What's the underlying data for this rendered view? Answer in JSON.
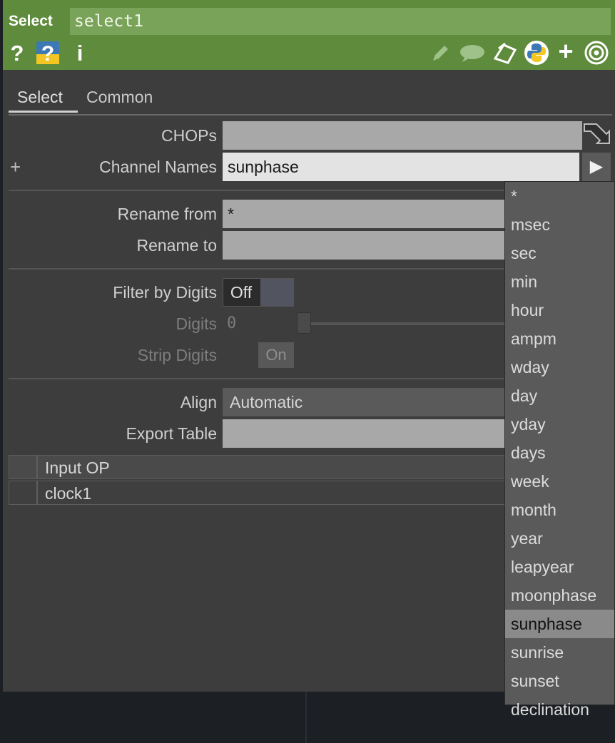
{
  "header": {
    "op_type": "Select",
    "op_name": "select1",
    "left_icons": [
      "help-icon",
      "python-help-icon",
      "info-icon"
    ],
    "right_icons": [
      "edit-icon",
      "comment-icon",
      "clone-icon",
      "python-icon",
      "add-icon",
      "viewer-icon"
    ],
    "glyphs": {
      "help": "?",
      "python_help": "?",
      "info": "i",
      "add": "+"
    }
  },
  "tabs": [
    {
      "label": "Select",
      "active": true
    },
    {
      "label": "Common",
      "active": false
    }
  ],
  "params": {
    "chops": {
      "label": "CHOPs",
      "value": ""
    },
    "channel_names": {
      "label": "Channel Names",
      "value": "sunphase",
      "add_glyph": "+",
      "menu_glyph": "▶"
    },
    "rename_from": {
      "label": "Rename from",
      "value": "*"
    },
    "rename_to": {
      "label": "Rename to",
      "value": ""
    },
    "filter_by_digits": {
      "label": "Filter by Digits",
      "value": "Off"
    },
    "digits": {
      "label": "Digits",
      "value": "0",
      "enabled": false
    },
    "strip_digits": {
      "label": "Strip Digits",
      "value": "On",
      "enabled": false
    },
    "align": {
      "label": "Align",
      "value": "Automatic"
    },
    "export_table": {
      "label": "Export Table",
      "value": ""
    }
  },
  "input_table": {
    "header": "Input OP",
    "rows": [
      "clock1"
    ]
  },
  "channel_menu": {
    "items": [
      "*",
      "msec",
      "sec",
      "min",
      "hour",
      "ampm",
      "wday",
      "day",
      "yday",
      "days",
      "week",
      "month",
      "year",
      "leapyear",
      "moonphase",
      "sunphase",
      "sunrise",
      "sunset",
      "declination"
    ],
    "selected": "sunphase"
  },
  "colors": {
    "header_bg": "#5f8b3c",
    "name_field_bg": "#7aa35a",
    "panel_bg": "#3d3d3d",
    "python_yellow": "#f3c623",
    "python_blue": "#3c78b5"
  }
}
